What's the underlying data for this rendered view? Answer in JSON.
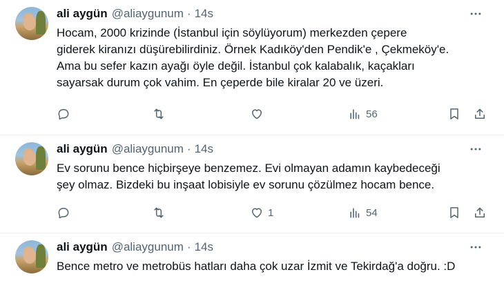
{
  "tweets": [
    {
      "name": "ali aygün",
      "handle": "@aliaygunum",
      "separator": "·",
      "time": "14s",
      "lines": [
        "Hocam, 2000 krizinde (İstanbul için söylüyorum) merkezden çepere",
        "giderek kiranızı düşürebilirdiniz. Örnek Kadıköy'den Pendik'e , Çekmeköy'e.",
        "Ama bu sefer kazın ayağı öyle değil. İstanbul çok kalabalık, kaçakları",
        "sayarsak durum çok vahim. En çeperde bile kiralar 20 ve üzeri."
      ],
      "likes": "",
      "views": "56"
    },
    {
      "name": "ali aygün",
      "handle": "@aliaygunum",
      "separator": "·",
      "time": "14s",
      "lines": [
        "Ev sorunu bence hiçbirşeye benzemez. Evi olmayan adamın kaybedeceği",
        "şey olmaz. Bizdeki bu inşaat lobisiyle ev sorunu çözülmez hocam bence."
      ],
      "likes": "1",
      "views": "54"
    },
    {
      "name": "ali aygün",
      "handle": "@aliaygunum",
      "separator": "·",
      "time": "14s",
      "lines": [
        "Bence metro ve metrobüs hatları daha çok uzar İzmit ve Tekirdağ'a doğru. :D"
      ]
    }
  ],
  "icons": {
    "more": "more-horizontal-icon",
    "reply": "reply-bubble-icon",
    "retweet": "retweet-icon",
    "like": "heart-icon",
    "views": "analytics-bars-icon",
    "bookmark": "bookmark-icon",
    "share": "share-upload-icon"
  },
  "colors": {
    "text": "#0f1419",
    "secondary": "#536471",
    "divider": "#eff3f4"
  }
}
